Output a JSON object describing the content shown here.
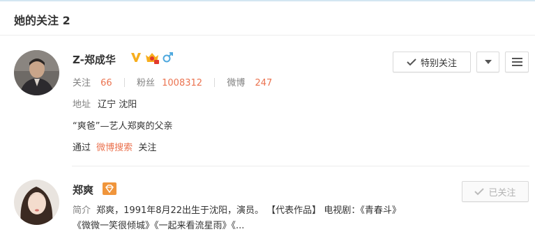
{
  "header": {
    "title": "她的关注 2"
  },
  "users": [
    {
      "name": "Z-郑成华",
      "stats": {
        "follow_label": "关注",
        "follow": "66",
        "fans_label": "粉丝",
        "fans": "1008312",
        "weibo_label": "微博",
        "weibo": "247"
      },
      "address_label": "地址",
      "address": "辽宁 沈阳",
      "bio": "“爽爸”—艺人郑爽的父亲",
      "via_prefix": "通过",
      "via_link": "微博搜索",
      "via_suffix": "关注",
      "follow_button": "特别关注"
    },
    {
      "name": "郑爽",
      "intro_label": "简介",
      "intro": "郑爽，1991年8月22出生于沈阳，演员。 【代表作品】 电视剧：《青春斗》《微微一笑很倾城》《一起来看流星雨》《...",
      "follow_button": "已关注"
    }
  ],
  "colors": {
    "accent": "#eb7350",
    "vip": "#f7ae1d",
    "male": "#4ea8de",
    "diamond": "#f0953b"
  }
}
